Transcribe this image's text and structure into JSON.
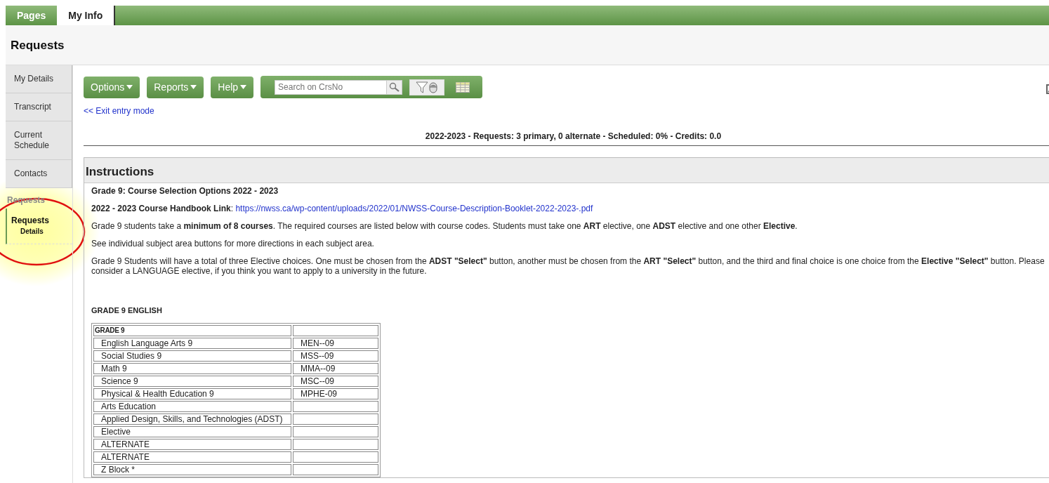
{
  "top_tabs": [
    {
      "label": "Pages",
      "selected": false
    },
    {
      "label": "My Info",
      "selected": true
    }
  ],
  "page_title": "Requests",
  "sidebar": {
    "items": [
      {
        "label": "My Details",
        "selected": false
      },
      {
        "label": "Transcript",
        "selected": false
      },
      {
        "label": "Current Schedule",
        "selected": false
      },
      {
        "label": "Contacts",
        "selected": false
      }
    ],
    "section": {
      "title": "Requests",
      "items": [
        {
          "label": "Requests",
          "sub": "Details",
          "selected": true
        }
      ]
    }
  },
  "toolbar": {
    "menus": [
      "Options",
      "Reports",
      "Help"
    ],
    "search": {
      "placeholder": "Search on CrsNo"
    }
  },
  "exit_link": "<< Exit entry mode",
  "summary": "2022-2023 - Requests: 3 primary, 0 alternate - Scheduled: 0% - Credits: 0.0",
  "instructions": {
    "title": "Instructions",
    "paragraphs": [
      {
        "text": "**Grade 9: Course Selection Options 2022 - 2023**"
      },
      {
        "text": "**2022 - 2023 Course Handbook Link**: ",
        "link": "https://nwss.ca/wp-content/uploads/2022/01/NWSS-Course-Description-Booklet-2022-2023-.pdf"
      },
      {
        "text": "Grade 9 students take a **minimum of 8 courses**. The required courses are listed below with course codes. Students must take one **ART** elective, one **ADST** elective and one other **Elective**."
      },
      {
        "text": "See individual subject area buttons for more directions in each subject area."
      },
      {
        "text": "Grade 9 Students will have a total of three Elective choices. One must be chosen from the **ADST \"Select\"** button, another must be chosen from the **ART \"Select\"** button, and the third and final choice is one choice from the **Elective \"Select\"** button.  Please consider a LANGUAGE elective, if you think you want to apply to a university in the future."
      }
    ],
    "section_heading": "GRADE 9 ENGLISH",
    "table": {
      "header": "GRADE 9",
      "rows": [
        [
          "English Language Arts 9",
          "MEN--09"
        ],
        [
          "Social Studies 9",
          "MSS--09"
        ],
        [
          "Math 9",
          "MMA--09"
        ],
        [
          "Science 9",
          "MSC--09"
        ],
        [
          "Physical & Health Education 9",
          "MPHE-09"
        ],
        [
          "Arts Education",
          ""
        ],
        [
          "Applied Design, Skills, and  Technologies (ADST)",
          ""
        ],
        [
          "Elective",
          ""
        ],
        [
          "ALTERNATE",
          ""
        ],
        [
          "ALTERNATE",
          ""
        ],
        [
          "Z Block *",
          ""
        ]
      ]
    }
  }
}
